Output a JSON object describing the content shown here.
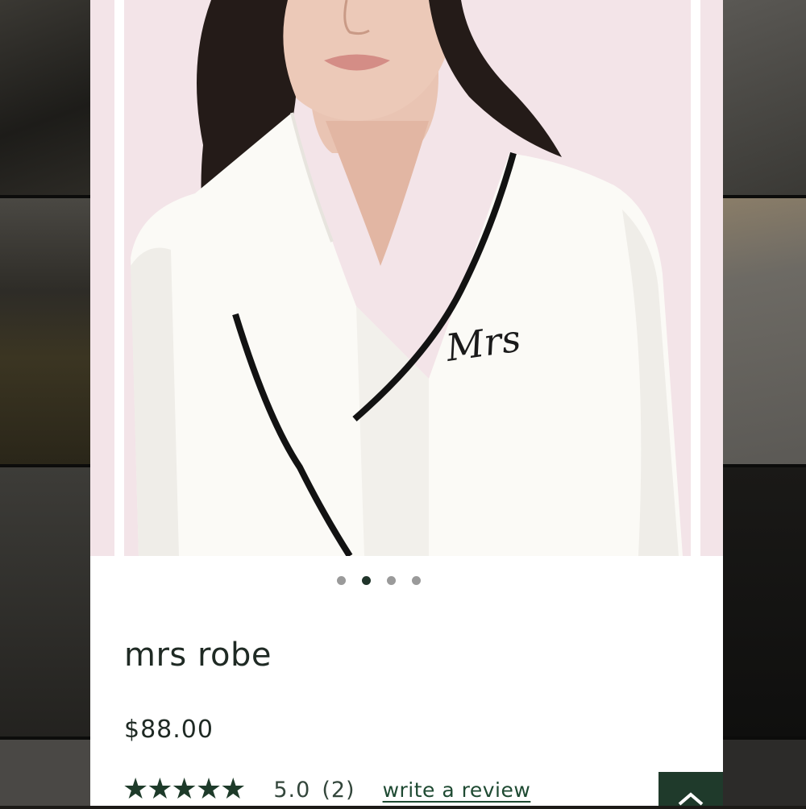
{
  "product": {
    "title": "mrs robe",
    "price": "$88.00",
    "rating": {
      "stars": "★★★★★",
      "value": "5.0",
      "count": "(2)",
      "review_link": "write a review"
    }
  },
  "carousel": {
    "total": 4,
    "active_index": 1
  },
  "colors": {
    "hero_background": "#f3e4e8",
    "accent": "#1f3a2b",
    "star": "#1e3b2a"
  },
  "icons": {
    "back_to_top": "chevron-up-icon"
  },
  "hero_embroidery": "Mrs"
}
